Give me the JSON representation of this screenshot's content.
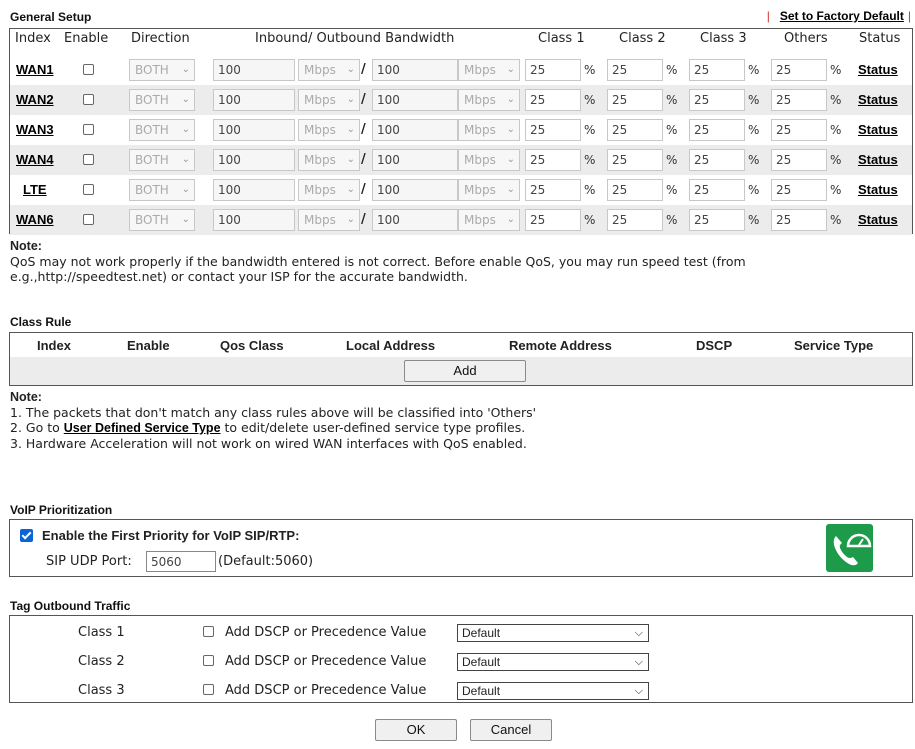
{
  "general_setup": {
    "title": "General Setup",
    "factory_default": "Set to Factory Default",
    "headers": {
      "index": "Index",
      "enable": "Enable",
      "direction": "Direction",
      "bandwidth": "Inbound/ Outbound Bandwidth",
      "class1": "Class 1",
      "class2": "Class 2",
      "class3": "Class 3",
      "others": "Others",
      "status": "Status"
    },
    "rows": [
      {
        "name": "WAN1",
        "direction": "BOTH",
        "inbound": "100",
        "in_unit": "Mbps",
        "outbound": "100",
        "out_unit": "Mbps",
        "c1": "25",
        "c2": "25",
        "c3": "25",
        "others": "25",
        "status": "Status"
      },
      {
        "name": "WAN2",
        "direction": "BOTH",
        "inbound": "100",
        "in_unit": "Mbps",
        "outbound": "100",
        "out_unit": "Mbps",
        "c1": "25",
        "c2": "25",
        "c3": "25",
        "others": "25",
        "status": "Status"
      },
      {
        "name": "WAN3",
        "direction": "BOTH",
        "inbound": "100",
        "in_unit": "Mbps",
        "outbound": "100",
        "out_unit": "Mbps",
        "c1": "25",
        "c2": "25",
        "c3": "25",
        "others": "25",
        "status": "Status"
      },
      {
        "name": "WAN4",
        "direction": "BOTH",
        "inbound": "100",
        "in_unit": "Mbps",
        "outbound": "100",
        "out_unit": "Mbps",
        "c1": "25",
        "c2": "25",
        "c3": "25",
        "others": "25",
        "status": "Status"
      },
      {
        "name": "LTE",
        "direction": "BOTH",
        "inbound": "100",
        "in_unit": "Mbps",
        "outbound": "100",
        "out_unit": "Mbps",
        "c1": "25",
        "c2": "25",
        "c3": "25",
        "others": "25",
        "status": "Status"
      },
      {
        "name": "WAN6",
        "direction": "BOTH",
        "inbound": "100",
        "in_unit": "Mbps",
        "outbound": "100",
        "out_unit": "Mbps",
        "c1": "25",
        "c2": "25",
        "c3": "25",
        "others": "25",
        "status": "Status"
      }
    ],
    "percent": "%",
    "slash": "/",
    "note_title": "Note:",
    "note_line1": "QoS may not work properly if the bandwidth entered is not correct. Before enable QoS, you may run speed test (from",
    "note_line2": "e.g.,http://speedtest.net) or contact your ISP for the accurate bandwidth."
  },
  "class_rule": {
    "title": "Class Rule",
    "headers": [
      "Index",
      "Enable",
      "Qos Class",
      "Local Address",
      "Remote Address",
      "DSCP",
      "Service Type"
    ],
    "add_button": "Add",
    "note_title": "Note:",
    "note1": "1. The packets that don't match any class rules above will be classified into 'Others'",
    "note2_prefix": "2. Go to ",
    "note2_link": "User Defined Service Type",
    "note2_suffix": " to edit/delete user-defined service type profiles.",
    "note3": "3. Hardware Acceleration will not work on wired WAN interfaces with QoS enabled."
  },
  "voip": {
    "title": "VoIP Prioritization",
    "enable_label": "Enable the First Priority for VoIP SIP/RTP:",
    "enabled": true,
    "port_label": "SIP UDP Port:",
    "port_value": "5060",
    "default_hint": "(Default:5060)"
  },
  "tag_outbound": {
    "title": "Tag Outbound Traffic",
    "rows": [
      {
        "class": "Class 1",
        "label": "Add DSCP or Precedence Value",
        "value": "Default"
      },
      {
        "class": "Class 2",
        "label": "Add DSCP or Precedence Value",
        "value": "Default"
      },
      {
        "class": "Class 3",
        "label": "Add DSCP or Precedence Value",
        "value": "Default"
      }
    ]
  },
  "buttons": {
    "ok": "OK",
    "cancel": "Cancel"
  },
  "colors": {
    "voip_icon_bg": "#1e9b4a",
    "checkbox_checked": "#0a64d8",
    "alt_row": "#ececec",
    "factory_bar": "#d2302a"
  }
}
